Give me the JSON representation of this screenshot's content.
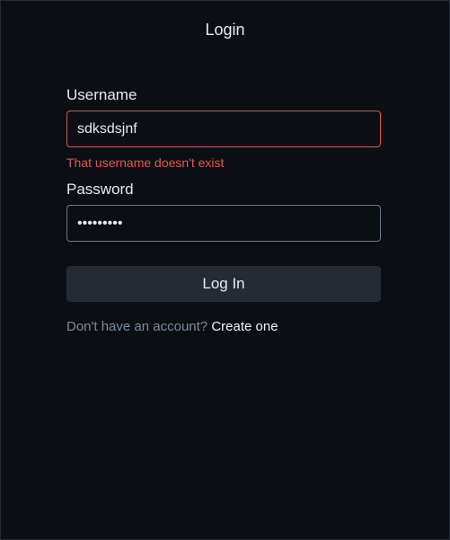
{
  "header": {
    "title": "Login"
  },
  "form": {
    "username": {
      "label": "Username",
      "value": "sdksdsjnf",
      "error": "That username doesn't exist"
    },
    "password": {
      "label": "Password",
      "value": "•••••••••"
    },
    "submit_label": "Log In"
  },
  "footer": {
    "prompt": "Don't have an account?",
    "link_label": "Create one"
  },
  "colors": {
    "background": "#0b0f14",
    "error": "#e2574c",
    "button": "#252b35",
    "muted": "#7e8a9c"
  }
}
